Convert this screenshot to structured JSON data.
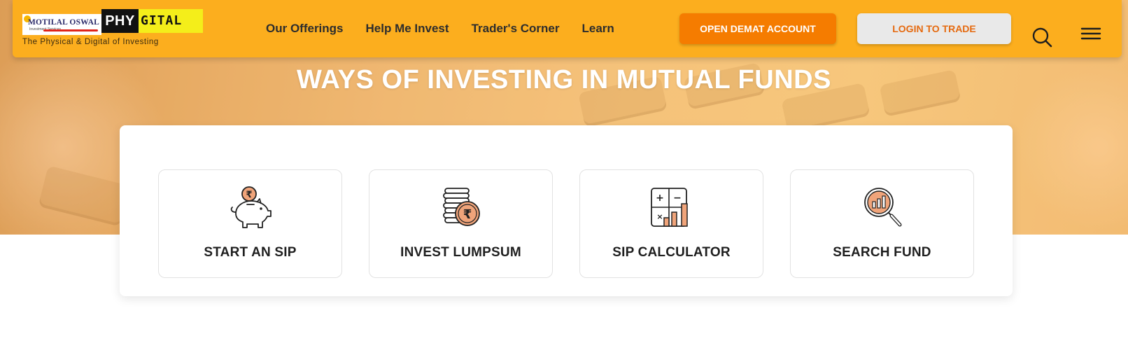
{
  "brand": {
    "logo_left": "MOTILAL OSWAL",
    "logo_sub": "Investment Services",
    "logo_phy": "PHY",
    "logo_gital": "GITAL",
    "tagline": "The Physical & Digital of Investing"
  },
  "nav": {
    "items": [
      {
        "label": "Our Offerings"
      },
      {
        "label": "Help Me Invest"
      },
      {
        "label": "Trader's Corner"
      },
      {
        "label": "Learn"
      }
    ]
  },
  "actions": {
    "demat_label": "OPEN DEMAT ACCOUNT",
    "login_label": "LOGIN TO TRADE",
    "search_icon": "search-icon",
    "menu_icon": "hamburger-menu-icon"
  },
  "hero": {
    "title": "WAYS OF INVESTING IN MUTUAL FUNDS"
  },
  "options": [
    {
      "label": "START AN SIP",
      "icon": "piggy-bank-rupee-icon"
    },
    {
      "label": "INVEST LUMPSUM",
      "icon": "coin-stack-rupee-icon"
    },
    {
      "label": "SIP CALCULATOR",
      "icon": "calculator-chart-icon"
    },
    {
      "label": "SEARCH FUND",
      "icon": "magnifier-chart-icon"
    }
  ],
  "colors": {
    "header_bg": "#fcae1e",
    "demat_bg": "#f57c00",
    "login_text": "#e56a10",
    "icon_accent": "#f0a47a"
  }
}
